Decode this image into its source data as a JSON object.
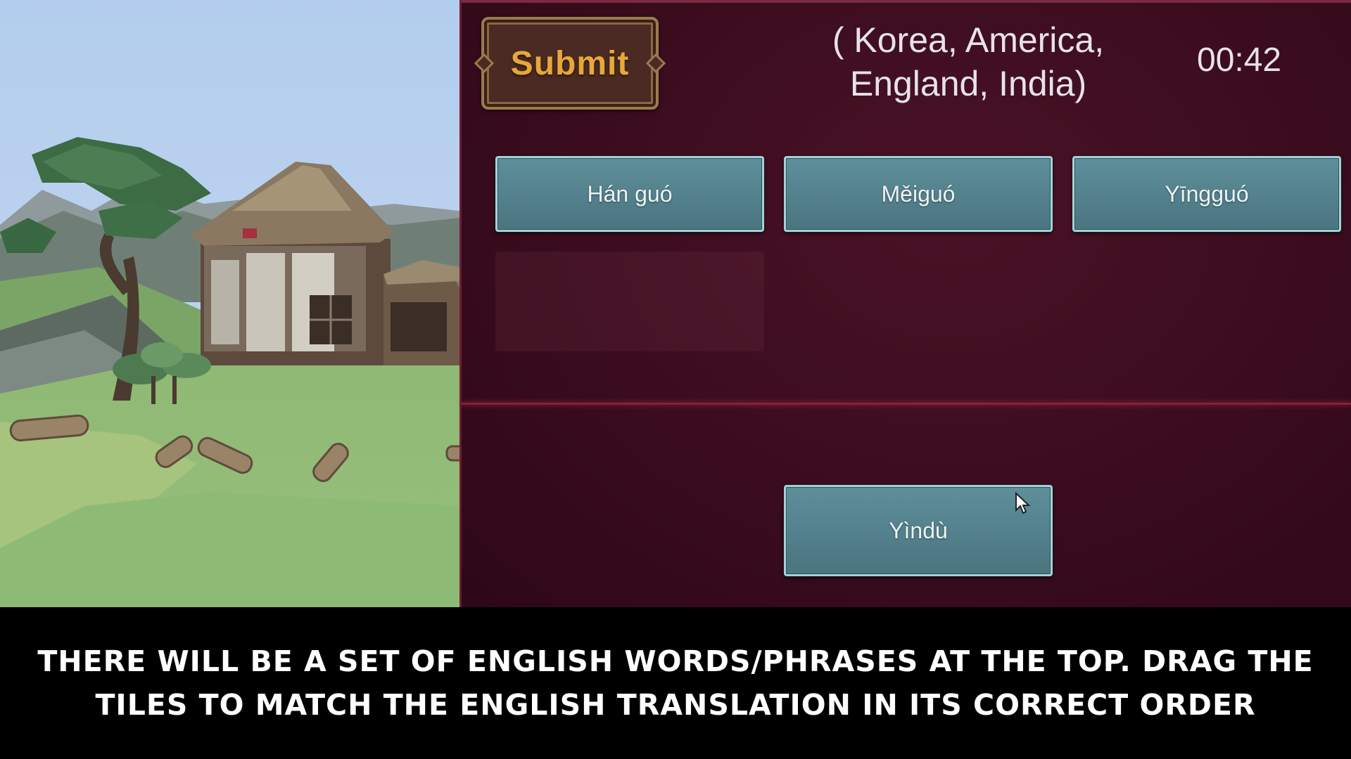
{
  "game": {
    "submit_label": "Submit",
    "prompt_line1": "( Korea, America,",
    "prompt_line2": "England, India)",
    "timer": "00:42",
    "tiles": [
      {
        "label": "Hán guó"
      },
      {
        "label": "Měiguó"
      },
      {
        "label": "Yīngguó"
      },
      {
        "label": "Yìndù"
      }
    ]
  },
  "caption": {
    "line1": "There will be a set of English words/phrases at the top. Drag the",
    "line2": "tiles to match the English translation in its correct order"
  },
  "colors": {
    "panel_bg": "#3a0c1e",
    "tile_bg": "#5a8a96",
    "tile_border": "#9fd4d4",
    "submit_text": "#e5a83a",
    "submit_frame": "#9b7a4c"
  },
  "icons": [
    "mouse-cursor-icon"
  ]
}
